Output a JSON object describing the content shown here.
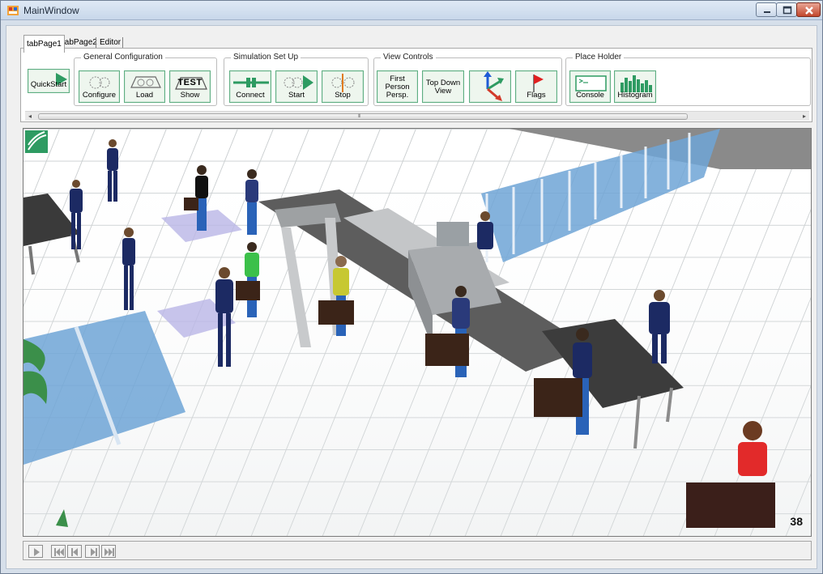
{
  "window": {
    "title": "MainWindow",
    "icon": "app-icon",
    "controls": [
      "minimize-icon",
      "maximize-icon",
      "close-icon"
    ]
  },
  "tabs": [
    {
      "label": "tabPage1",
      "active": true
    },
    {
      "label": "tabPage2",
      "active": false
    },
    {
      "label": "Editor",
      "active": false
    }
  ],
  "toolbar": {
    "quickstart_label": "QuickStart",
    "groups": [
      {
        "title": "General Configuration",
        "buttons": [
          {
            "label": "Configure",
            "icon": "configure-icon"
          },
          {
            "label": "Load",
            "icon": "load-icon"
          },
          {
            "label": "Show",
            "icon": "show-icon",
            "badge": "TEST"
          }
        ]
      },
      {
        "title": "Simulation Set Up",
        "buttons": [
          {
            "label": "Connect",
            "icon": "connect-icon"
          },
          {
            "label": "Start",
            "icon": "start-icon"
          },
          {
            "label": "Stop",
            "icon": "stop-icon"
          }
        ]
      },
      {
        "title": "View Controls",
        "buttons": [
          {
            "label": "First Person Persp.",
            "lines": [
              "First",
              "Person",
              "Persp."
            ]
          },
          {
            "label": "Top Down View",
            "lines": [
              "Top Down",
              "View"
            ]
          },
          {
            "label": "",
            "icon": "axes-icon"
          },
          {
            "label": "Flags",
            "icon": "flag-icon"
          }
        ]
      },
      {
        "title": "Place Holder",
        "buttons": [
          {
            "label": "Console",
            "icon": "console-icon"
          },
          {
            "label": "Histogram",
            "icon": "histogram-icon"
          }
        ]
      }
    ],
    "scrollbar_grip": "III"
  },
  "viewport": {
    "scene": "airport-security-checkpoint-simulation",
    "frame_counter": "38"
  },
  "playback": {
    "buttons": [
      "play-icon",
      "skip-to-start-icon",
      "step-back-icon",
      "step-forward-icon",
      "skip-to-end-icon"
    ]
  },
  "colors": {
    "accent": "#2e9b62",
    "glass": "#6fa4d6",
    "officer": "#1c2a63",
    "floor_tile": "#ffffff",
    "grout": "#c9cdcf"
  }
}
